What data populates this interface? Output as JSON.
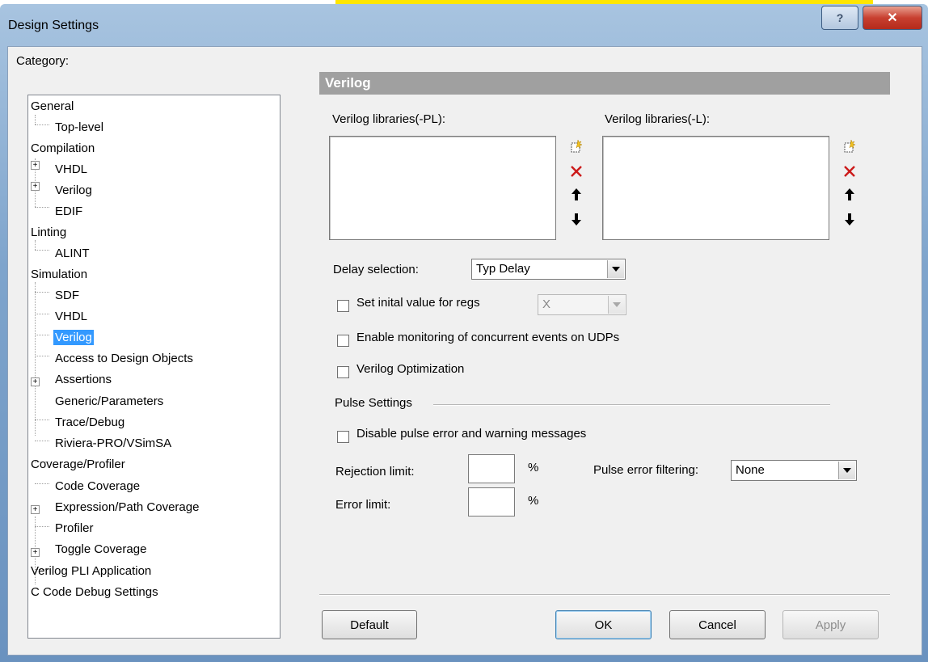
{
  "window": {
    "title": "Design Settings",
    "help_label": "?",
    "close_label": "✕"
  },
  "category_label": "Category:",
  "tree": {
    "items": [
      {
        "label": "General"
      },
      {
        "label": "Top-level"
      },
      {
        "label": "Compilation"
      },
      {
        "label": "VHDL"
      },
      {
        "label": "Verilog"
      },
      {
        "label": "EDIF"
      },
      {
        "label": "Linting"
      },
      {
        "label": "ALINT"
      },
      {
        "label": "Simulation"
      },
      {
        "label": "SDF"
      },
      {
        "label": "VHDL"
      },
      {
        "label": "Verilog"
      },
      {
        "label": "Access to Design Objects"
      },
      {
        "label": "Assertions"
      },
      {
        "label": "Generic/Parameters"
      },
      {
        "label": "Trace/Debug"
      },
      {
        "label": "Riviera-PRO/VSimSA"
      },
      {
        "label": "Coverage/Profiler"
      },
      {
        "label": "Code Coverage"
      },
      {
        "label": "Expression/Path Coverage"
      },
      {
        "label": "Profiler"
      },
      {
        "label": "Toggle Coverage"
      },
      {
        "label": "Verilog PLI Application"
      },
      {
        "label": "C Code Debug Settings"
      }
    ],
    "expander_symbol": "+"
  },
  "panel": {
    "header": "Verilog",
    "libs_pl_label": "Verilog libraries(-PL):",
    "libs_l_label": "Verilog libraries(-L):",
    "delay_label": "Delay selection:",
    "delay_value": "Typ Delay",
    "init_regs_label": "Set inital value for regs",
    "init_regs_value": "X",
    "monitor_udp_label": "Enable monitoring of concurrent events on UDPs",
    "optimization_label": "Verilog Optimization",
    "pulse_group_label": "Pulse Settings",
    "disable_pulse_label": "Disable pulse error and warning messages",
    "rejection_label": "Rejection limit:",
    "error_limit_label": "Error limit:",
    "percent": "%",
    "pulse_filter_label": "Pulse error filtering:",
    "pulse_filter_value": "None"
  },
  "buttons": {
    "default": "Default",
    "ok": "OK",
    "cancel": "Cancel",
    "apply": "Apply"
  }
}
